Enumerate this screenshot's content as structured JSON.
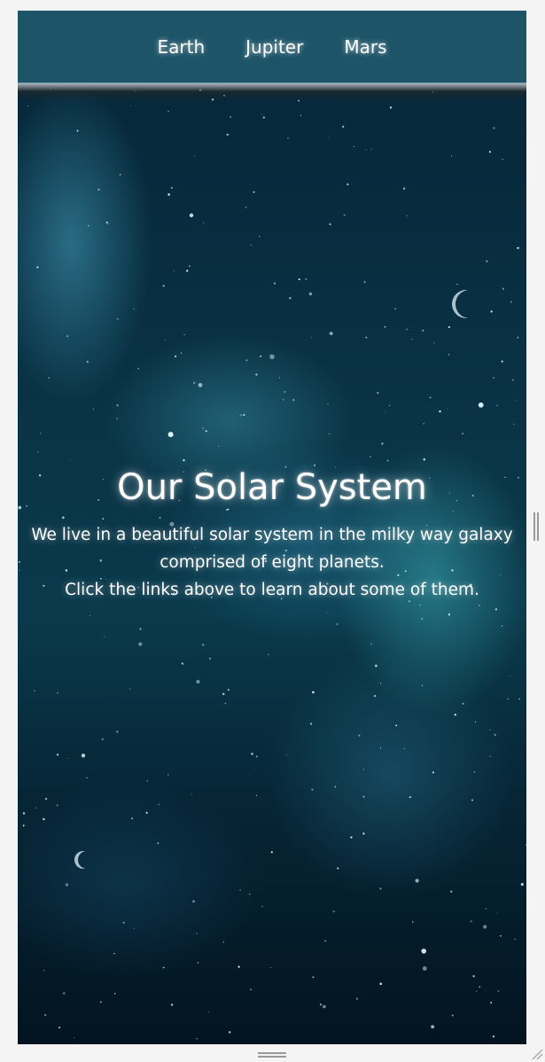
{
  "nav": {
    "links": [
      "Earth",
      "Jupiter",
      "Mars"
    ]
  },
  "hero": {
    "title": "Our Solar System",
    "text_line1": "We live in a beautiful solar system in the milky way galaxy comprised of eight planets.",
    "text_line2": "Click the links above to learn about some of them."
  },
  "colors": {
    "navbar": "#1d5468",
    "page_bg": "#f4f4f4",
    "space_dark": "#02121c"
  }
}
